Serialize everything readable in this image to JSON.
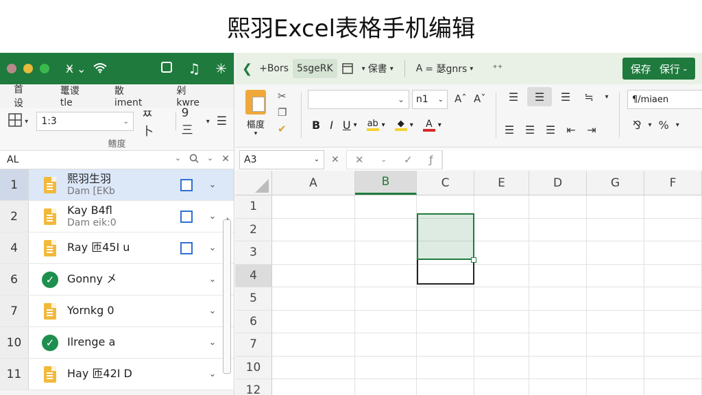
{
  "page_title": "熙羽Excel表格手机编辑",
  "colors": {
    "brand_green": "#1f7a3d",
    "selected_row": "#dce7f8",
    "checkbox_blue": "#2f6fd0",
    "file_orange": "#f2b93a"
  },
  "left_panel": {
    "topbar": {
      "left_text": "Ӿ ⌄"
    },
    "tabs": [
      "首设",
      "鼍谡tle",
      "散iment",
      "剁kwre"
    ],
    "toolbar": {
      "zoom_value": "1:3",
      "icon_label": "ㅉ卜",
      "sort_label": "9三"
    },
    "subtitle": "鳍度",
    "namebar": {
      "value": "AL"
    },
    "rows": [
      {
        "num": "1",
        "title": "熙羽生羽",
        "subtitle": "Dam [EKb",
        "icon": "file-icon",
        "checkbox": true,
        "selected": true
      },
      {
        "num": "2",
        "title": "Kay B4fl",
        "subtitle": "Dam eik:0",
        "icon": "file-icon",
        "checkbox": true,
        "selected": false
      },
      {
        "num": "4",
        "title": "Ray 匝45I u",
        "subtitle": "",
        "icon": "file-icon",
        "checkbox": true,
        "selected": false
      },
      {
        "num": "6",
        "title": "Gonny 㐅",
        "subtitle": "",
        "icon": "check-icon",
        "checkbox": false,
        "selected": false
      },
      {
        "num": "7",
        "title": "Yornkg 0",
        "subtitle": "",
        "icon": "file-icon",
        "checkbox": false,
        "selected": false
      },
      {
        "num": "10",
        "title": "Ilrenge a",
        "subtitle": "",
        "icon": "check-icon",
        "checkbox": false,
        "selected": false
      },
      {
        "num": "11",
        "title": "Hay 匝42I D",
        "subtitle": "",
        "icon": "file-icon",
        "checkbox": false,
        "selected": false
      }
    ]
  },
  "right_panel": {
    "topbar": {
      "back_label": "+Bors",
      "tab_label": "5sgeRK",
      "save_menu": "保書",
      "styles_menu": "= 瑟gnrs",
      "more_label": "⁺⁺",
      "save_button": "保存",
      "save_options": "保行 -"
    },
    "ribbon": {
      "paste_label": "樞度",
      "font_size": "n1",
      "number_format": "¶/miaen"
    },
    "formula_bar": {
      "cell_ref": "A3",
      "formula": ""
    },
    "columns": [
      "A",
      "B",
      "C",
      "E",
      "D",
      "G",
      "F"
    ],
    "active_column": "B",
    "row_numbers": [
      "1",
      "2",
      "3",
      "4",
      "5",
      "6",
      "7",
      "10",
      "12"
    ],
    "active_row": "4"
  }
}
